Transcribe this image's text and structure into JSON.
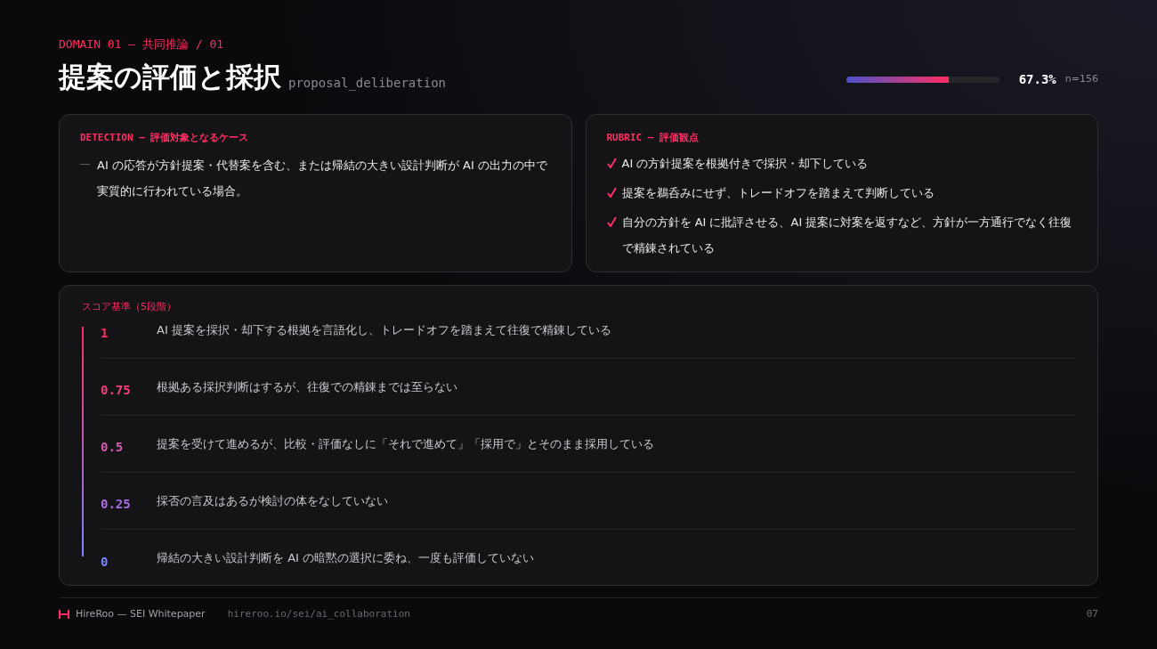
{
  "header": {
    "eyebrow": "DOMAIN 01 — 共同推論 / 01",
    "title": "提案の評価と採択",
    "slug": "proposal_deliberation"
  },
  "score": {
    "level": 0.673,
    "percent": "67.3%",
    "count": "n=156"
  },
  "detection": {
    "heading": "DETECTION — 評価対象となるケース",
    "items": [
      "AI の応答が方針提案・代替案を含む、または帰結の大きい設計判断が AI の出力の中で実質的に行われている場合。"
    ]
  },
  "rubric": {
    "heading": "RUBRIC — 評価観点",
    "items": [
      "AI の方針提案を根拠付きで採択・却下している",
      "提案を鵜呑みにせず、トレードオフを踏まえて判断している",
      "自分の方針を AI に批評させる、AI 提案に対案を返すなど、方針が一方通行でなく往復で精錬されている"
    ]
  },
  "scale": {
    "heading": "スコア基準（5段階）",
    "levels": [
      {
        "score": "1",
        "color": "#ff2e63",
        "text": "AI 提案を採択・却下する根拠を言語化し、トレードオフを踏まえて往復で精錬している"
      },
      {
        "score": "0.75",
        "color": "#f2407a",
        "text": "根拠ある採択判断はするが、往復での精錬までは至らない"
      },
      {
        "score": "0.5",
        "color": "#d458ad",
        "text": "提案を受けて進めるが、比較・評価なしに「それで進めて」「採用で」とそのまま採用している"
      },
      {
        "score": "0.25",
        "color": "#a66ee0",
        "text": "採否の言及はあるが検討の体をなしていない"
      },
      {
        "score": "0",
        "color": "#7a85ff",
        "text": "帰結の大きい設計判断を AI の暗黙の選択に委ね、一度も評価していない"
      }
    ]
  },
  "footer": {
    "brand": "HireRoo — SEI Whitepaper",
    "url": "hireroo.io/sei/ai_collaboration",
    "page": "07"
  }
}
